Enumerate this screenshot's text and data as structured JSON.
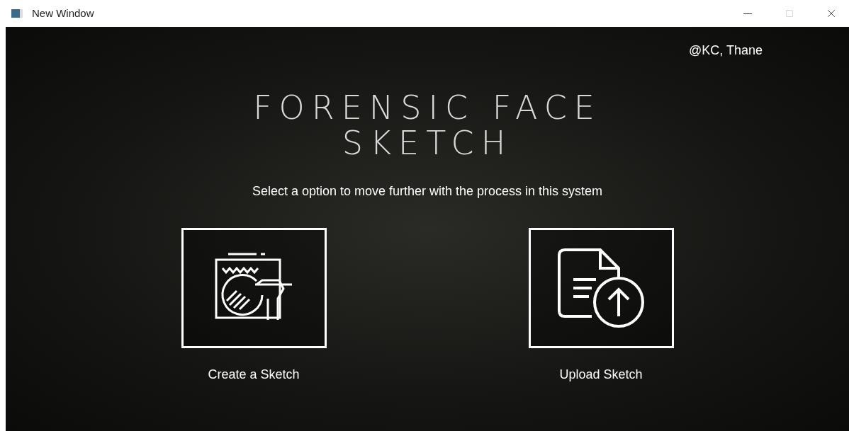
{
  "window": {
    "title": "New Window"
  },
  "credit": "@KC, Thane",
  "title": "FORENSIC FACE SKETCH",
  "subtitle": "Select a option to move further with the process in this system",
  "options": [
    {
      "kind": "create",
      "label": "Create a Sketch"
    },
    {
      "kind": "upload",
      "label": "Upload Sketch"
    }
  ]
}
